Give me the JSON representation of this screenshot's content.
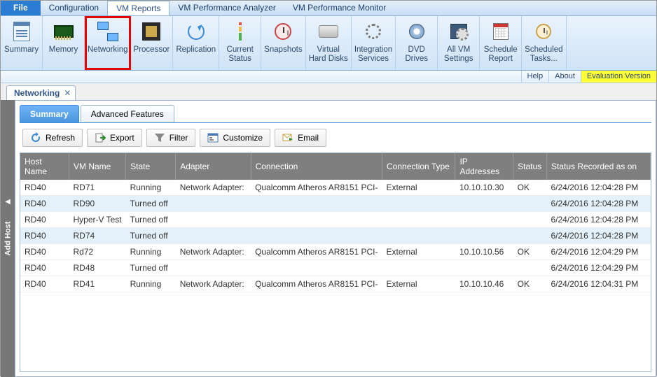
{
  "menubar": {
    "file": "File",
    "items": [
      "Configuration",
      "VM Reports",
      "VM Performance Analyzer",
      "VM Performance Monitor"
    ],
    "active_index": 1
  },
  "ribbon": [
    {
      "label": "Summary",
      "icon": "report"
    },
    {
      "label": "Memory",
      "icon": "mem"
    },
    {
      "label": "Networking",
      "icon": "net",
      "highlight": true
    },
    {
      "label": "Processor",
      "icon": "cpu"
    },
    {
      "label": "Replication",
      "icon": "repl"
    },
    {
      "label": "Current\nStatus",
      "icon": "status"
    },
    {
      "label": "Snapshots",
      "icon": "snap"
    },
    {
      "label": "Virtual\nHard Disks",
      "icon": "disk"
    },
    {
      "label": "Integration\nServices",
      "icon": "gear"
    },
    {
      "label": "DVD\nDrives",
      "icon": "dvd"
    },
    {
      "label": "All VM\nSettings",
      "icon": "allvm"
    },
    {
      "label": "Schedule\nReport",
      "icon": "sched"
    },
    {
      "label": "Scheduled\nTasks...",
      "icon": "task"
    }
  ],
  "infobar": {
    "help": "Help",
    "about": "About",
    "eval": "Evaluation Version"
  },
  "doc_tab": {
    "title": "Networking"
  },
  "side_panel": {
    "label": "Add Host"
  },
  "inner_tabs": {
    "items": [
      "Summary",
      "Advanced Features"
    ],
    "active_index": 0
  },
  "toolbar": [
    {
      "label": "Refresh"
    },
    {
      "label": "Export"
    },
    {
      "label": "Filter"
    },
    {
      "label": "Customize"
    },
    {
      "label": "Email"
    }
  ],
  "grid": {
    "columns": [
      "Host Name",
      "VM Name",
      "State",
      "Adapter",
      "Connection",
      "Connection Type",
      "IP Addresses",
      "Status",
      "Status Recorded as on"
    ],
    "rows": [
      {
        "host": "RD40",
        "vm": "RD71",
        "state": "Running",
        "adapter": "Network Adapter:",
        "conn": "Qualcomm Atheros AR8151 PCI-",
        "ctype": "External",
        "ip": "10.10.10.30",
        "status": "OK",
        "rec": "6/24/2016 12:04:28 PM",
        "sel": false
      },
      {
        "host": "RD40",
        "vm": "RD90",
        "state": "Turned off",
        "adapter": "",
        "conn": "",
        "ctype": "",
        "ip": "",
        "status": "",
        "rec": "6/24/2016 12:04:28 PM",
        "sel": true
      },
      {
        "host": "RD40",
        "vm": "Hyper-V Test",
        "state": "Turned off",
        "adapter": "",
        "conn": "",
        "ctype": "",
        "ip": "",
        "status": "",
        "rec": "6/24/2016 12:04:28 PM",
        "sel": false
      },
      {
        "host": "RD40",
        "vm": "RD74",
        "state": "Turned off",
        "adapter": "",
        "conn": "",
        "ctype": "",
        "ip": "",
        "status": "",
        "rec": "6/24/2016 12:04:28 PM",
        "sel": true
      },
      {
        "host": "RD40",
        "vm": "Rd72",
        "state": "Running",
        "adapter": "Network Adapter:",
        "conn": "Qualcomm Atheros AR8151 PCI-",
        "ctype": "External",
        "ip": "10.10.10.56",
        "status": "OK",
        "rec": "6/24/2016 12:04:29 PM",
        "sel": false
      },
      {
        "host": "RD40",
        "vm": "RD48",
        "state": "Turned off",
        "adapter": "",
        "conn": "",
        "ctype": "",
        "ip": "",
        "status": "",
        "rec": "6/24/2016 12:04:29 PM",
        "sel": false
      },
      {
        "host": "RD40",
        "vm": "RD41",
        "state": "Running",
        "adapter": "Network Adapter:",
        "conn": "Qualcomm Atheros AR8151 PCI-",
        "ctype": "External",
        "ip": "10.10.10.46",
        "status": "OK",
        "rec": "6/24/2016 12:04:31 PM",
        "sel": false
      }
    ]
  }
}
